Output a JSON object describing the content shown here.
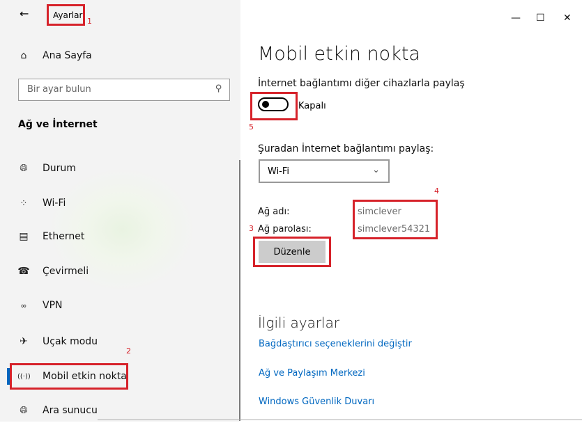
{
  "window": {
    "back_icon": "arrow-left",
    "title": "Ayarlar",
    "controls": {
      "minimize": "—",
      "maximize": "☐",
      "close": "✕"
    }
  },
  "sidebar": {
    "home_label": "Ana Sayfa",
    "search_placeholder": "Bir ayar bulun",
    "section_title": "Ağ ve İnternet",
    "items": [
      {
        "icon": "globe-status-icon",
        "label": "Durum"
      },
      {
        "icon": "wifi-icon",
        "label": "Wi-Fi"
      },
      {
        "icon": "ethernet-icon",
        "label": "Ethernet"
      },
      {
        "icon": "dialup-icon",
        "label": "Çevirmeli"
      },
      {
        "icon": "vpn-icon",
        "label": "VPN"
      },
      {
        "icon": "airplane-icon",
        "label": "Uçak modu"
      },
      {
        "icon": "hotspot-icon",
        "label": "Mobil etkin nokta",
        "selected": true
      },
      {
        "icon": "globe-icon",
        "label": "Ara sunucu"
      }
    ]
  },
  "main": {
    "title": "Mobil etkin nokta",
    "share_label": "İnternet bağlantımı diğer cihazlarla paylaş",
    "toggle_state": "Kapalı",
    "toggle_on": false,
    "from_label": "Şuradan İnternet bağlantımı paylaş:",
    "dropdown_value": "Wi-Fi",
    "network_name_label": "Ağ adı:",
    "network_name_value": "simclever",
    "network_password_label": "Ağ parolası:",
    "network_password_value": "simclever54321",
    "edit_button": "Düzenle",
    "related_title": "İlgili ayarlar",
    "links": [
      "Bağdaştırıcı seçeneklerini değiştir",
      "Ağ ve Paylaşım Merkezi",
      "Windows Güvenlik Duvarı"
    ]
  },
  "annotations": [
    "1",
    "2",
    "3",
    "4",
    "5"
  ],
  "colors": {
    "accent": "#0067c0",
    "annotation": "#d6222a"
  }
}
